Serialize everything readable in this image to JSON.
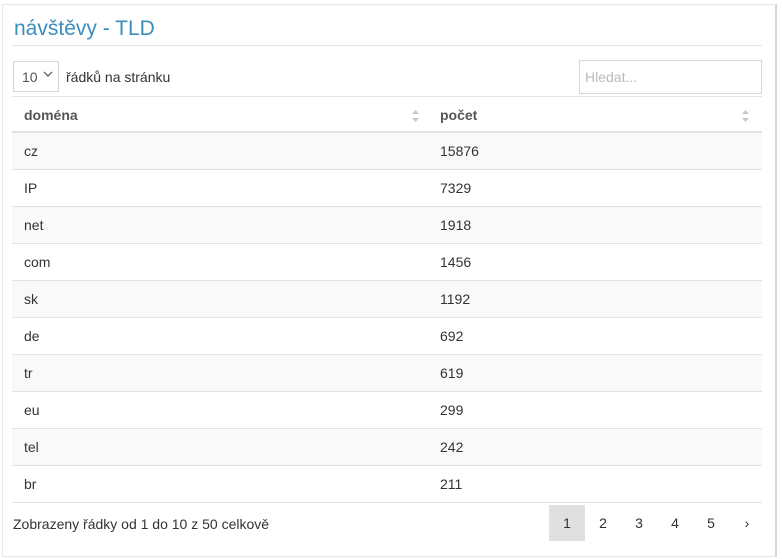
{
  "title": "návštěvy - TLD",
  "controls": {
    "page_size": "10",
    "page_size_label": "řádků na stránku",
    "search_placeholder": "Hledat..."
  },
  "table": {
    "columns": [
      "doména",
      "počet"
    ],
    "rows": [
      [
        "cz",
        "15876"
      ],
      [
        "IP",
        "7329"
      ],
      [
        "net",
        "1918"
      ],
      [
        "com",
        "1456"
      ],
      [
        "sk",
        "1192"
      ],
      [
        "de",
        "692"
      ],
      [
        "tr",
        "619"
      ],
      [
        "eu",
        "299"
      ],
      [
        "tel",
        "242"
      ],
      [
        "br",
        "211"
      ]
    ]
  },
  "footer": {
    "summary": "Zobrazeny řádky od 1 do 10 z 50 celkově"
  },
  "pagination": {
    "pages": [
      "1",
      "2",
      "3",
      "4",
      "5"
    ],
    "active": "1",
    "next": "›"
  },
  "colors": {
    "title": "#3c8dbc",
    "active_page_bg": "#e0e0e0",
    "striped_row_bg": "#f9f9f9"
  }
}
